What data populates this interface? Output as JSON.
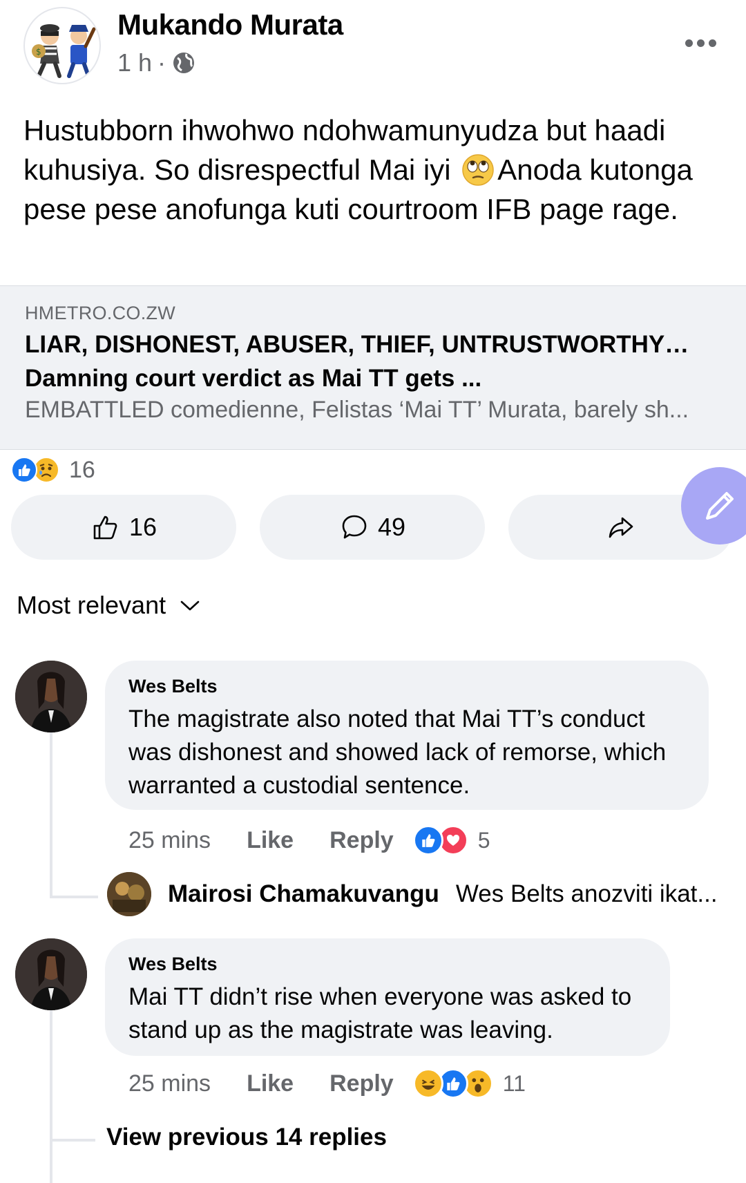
{
  "post": {
    "author": "Mukando Murata",
    "time": "1 h",
    "separator": "·",
    "text_part1": "Hustubborn ihwohwo ndohwamunyudza but haadi kuhusiya. So disrespectful Mai iyi ",
    "text_emoji": "eye-roll-emoji",
    "text_part2": "Anoda kutonga pese pese anofunga kuti courtroom IFB page rage."
  },
  "link_preview": {
    "domain": "HMETRO.CO.ZW",
    "title": "LIAR, DISHONEST, ABUSER, THIEF, UNTRUSTWORTHY…Damning court verdict as Mai TT gets ...",
    "description": "EMBATTLED comedienne, Felistas ‘Mai TT’ Murata, barely sh..."
  },
  "reactions": {
    "icons": [
      "like",
      "sad"
    ],
    "count": "16"
  },
  "actions": {
    "like_count": "16",
    "comment_count": "49"
  },
  "sort": {
    "label": "Most relevant"
  },
  "comments": [
    {
      "author": "Wes Belts",
      "text": "The magistrate also noted that Mai TT’s conduct was dishonest and showed lack of remorse, which warranted a custodial sentence.",
      "time": "25 mins",
      "like_label": "Like",
      "reply_label": "Reply",
      "reaction_icons": [
        "like",
        "love"
      ],
      "reaction_count": "5"
    },
    {
      "author": "Wes Belts",
      "text": "Mai TT didn’t rise when everyone was asked to stand up as the magistrate was leaving.",
      "time": "25 mins",
      "like_label": "Like",
      "reply_label": "Reply",
      "reaction_icons": [
        "haha",
        "like",
        "wow"
      ],
      "reaction_count": "11"
    }
  ],
  "reply_preview": {
    "author": "Mairosi Chamakuvangu",
    "snippet": "Wes Belts anozviti ikat..."
  },
  "view_previous": "View previous 14 replies",
  "colors": {
    "like_blue": "#1877f2",
    "love_red": "#f33e58",
    "emoji_yellow": "#f7b928",
    "fab_purple": "#a8a7f5"
  }
}
